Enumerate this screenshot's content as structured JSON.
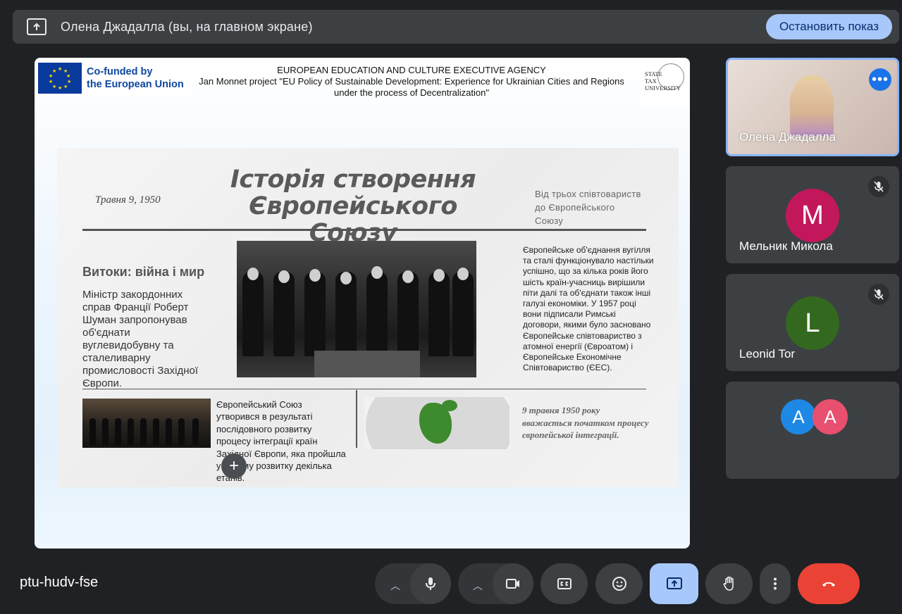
{
  "banner": {
    "presenting_text": "Олена Джадалла (вы, на главном экране)",
    "stop_label": "Остановить показ"
  },
  "slide": {
    "eu_logo_text": "Co-funded by the European Union",
    "header_line1": "EUROPEAN EDUCATION AND CULTURE EXECUTIVE AGENCY",
    "header_line2": "Jan Monnet project \"EU Policy of Sustainable Development: Experience for Ukrainian Cities and Regions under the process of Decentralization\"",
    "university_logo_text": "STATE TAX UNIVERSITY",
    "newspaper": {
      "date": "Травня 9, 1950",
      "title": "Історія створення Європейського Союзу",
      "subtitle": "Від трьох співтовариств до Європейського Союзу",
      "left_heading": "Витоки: війна і мир",
      "left_paragraph": "Міністр закордонних справ Франції Роберт Шуман запропонував об'єднати вуглевидобувну та сталеливарну промисловості Західної Європи.",
      "right_paragraph": "Європейське об'єднання вугілля та сталі функціонувало настільки успішно, що за кілька років його шість країн-учасниць вирішили піти далі та об'єднати також інші галузі економіки. У 1957 році вони підписали Римські договори, якими було засновано Європейське співтовариство з атомної енергії (Євроатом) і Європейське Економічне Співтовариство (ЄЕС).",
      "middle_paragraph": "Європейський Союз утворився в результаті послідовного розвитку процесу інтеграції країн Західної Європи, яка пройшла у своєму розвитку декілька етапів.",
      "quote": "9 травня 1950 року вважається початком процесу європейської інтеграції."
    },
    "plus_label": "+"
  },
  "participants": [
    {
      "name": "Олена Джадалла",
      "type": "video"
    },
    {
      "name": "Мельник Микола",
      "initial": "M",
      "color": "#c2185b",
      "muted": true
    },
    {
      "name": "Leonid Tor",
      "initial": "L",
      "color": "#33691e",
      "muted": true
    },
    {
      "initials": [
        "A",
        "A"
      ],
      "colors": [
        "#1e88e5",
        "#e94f6e"
      ]
    }
  ],
  "bottom_bar": {
    "meeting_code": "ptu-hudv-fse",
    "controls": [
      "mic-options",
      "microphone",
      "camera-options",
      "camera",
      "captions",
      "reactions",
      "present",
      "raise-hand",
      "more-options",
      "leave-call"
    ]
  }
}
